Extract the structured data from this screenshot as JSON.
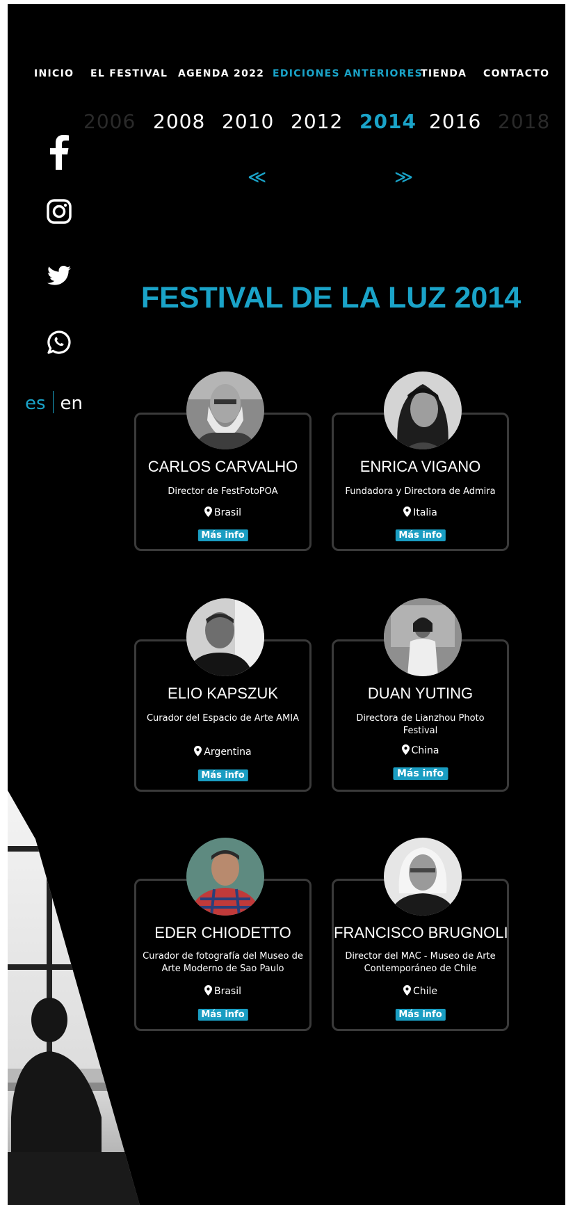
{
  "nav": {
    "items": [
      "INICIO",
      "EL FESTIVAL",
      "AGENDA 2022",
      "EDICIONES ANTERIORES",
      "TIENDA",
      "CONTACTO"
    ],
    "active": "EDICIONES ANTERIORES"
  },
  "years": {
    "items": [
      "2006",
      "2008",
      "2010",
      "2012",
      "2014",
      "2016",
      "2018"
    ],
    "selected": "2014",
    "prev_arrow": "≪",
    "next_arrow": "≫"
  },
  "social": {
    "icons": [
      "facebook-icon",
      "instagram-icon",
      "twitter-icon",
      "whatsapp-icon"
    ]
  },
  "language": {
    "es": "es",
    "en": "en",
    "active": "es"
  },
  "title": "FESTIVAL DE LA LUZ 2014",
  "people": [
    {
      "name": "CARLOS CARVALHO",
      "role": "Director de FestFotoPOA",
      "country": "Brasil",
      "button": "Más info"
    },
    {
      "name": "ENRICA VIGANO",
      "role": "Fundadora y Directora de Admira",
      "country": "Italia",
      "button": "Más info"
    },
    {
      "name": "ELIO KAPSZUK",
      "role": "Curador del Espacio de Arte AMIA",
      "country": "Argentina",
      "button": "Más info"
    },
    {
      "name": "DUAN YUTING",
      "role": "Directora de Lianzhou Photo Festival",
      "country": "China",
      "button": "Más info"
    },
    {
      "name": "EDER CHIODETTO",
      "role": "Curador de fotografía del Museo de Arte Moderno de Sao Paulo",
      "country": "Brasil",
      "button": "Más info"
    },
    {
      "name": "FRANCISCO BRUGNOLI",
      "role": "Director del MAC - Museo de Arte Contemporáneo de Chile",
      "country": "Chile",
      "button": "Más info"
    }
  ],
  "colors": {
    "accent": "#1aa3c8",
    "background": "#000000",
    "card_border": "#3a3a3a"
  }
}
